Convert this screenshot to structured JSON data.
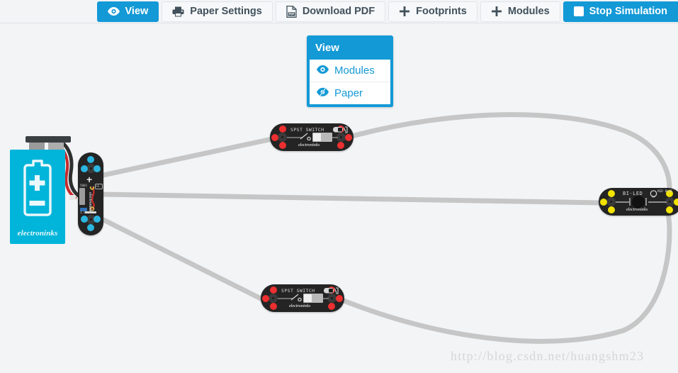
{
  "toolbar": {
    "buttons": [
      {
        "label": "View",
        "icon": "eye-icon",
        "style": "primary"
      },
      {
        "label": "Paper Settings",
        "icon": "printer-icon",
        "style": "default"
      },
      {
        "label": "Download PDF",
        "icon": "pdf-file-icon",
        "style": "default"
      },
      {
        "label": "Footprints",
        "icon": "plus-icon",
        "style": "default"
      },
      {
        "label": "Modules",
        "icon": "plus-icon",
        "style": "default"
      },
      {
        "label": "Stop Simulation",
        "icon": "stop-square-icon",
        "style": "primary"
      }
    ]
  },
  "view_dropdown": {
    "title": "View",
    "items": [
      {
        "label": "Modules",
        "icon": "eye-icon"
      },
      {
        "label": "Paper",
        "icon": "eye-slash-icon"
      }
    ]
  },
  "canvas": {
    "battery": {
      "brand": "electroninks",
      "symbol": "battery-plus-minus-icon"
    },
    "modules": [
      {
        "id": "power-module",
        "name": "power-module",
        "title": "",
        "brand": "electroninks",
        "pad_color": "#2bb6e0",
        "orientation": "vertical",
        "labels": {
          "part": "5001",
          "pin": "+1",
          "chip": "1.0",
          "chip2": "B4-5"
        }
      },
      {
        "id": "spst-switch-top",
        "name": "spst-switch-module",
        "title": "SPST SWITCH",
        "brand": "electroninks",
        "pad_color": "#ec2f2f",
        "orientation": "horizontal"
      },
      {
        "id": "spst-switch-bottom",
        "name": "spst-switch-module",
        "title": "SPST SWITCH",
        "brand": "electroninks",
        "pad_color": "#ec2f2f",
        "orientation": "horizontal"
      },
      {
        "id": "bi-led",
        "name": "bi-led-module",
        "title": "BI-LED",
        "subtitle": "RED BLUE",
        "brand": "electroninks",
        "pad_color": "#f2e300",
        "orientation": "horizontal"
      }
    ],
    "trace_color": "#c6c6c6"
  },
  "watermark": {
    "text": "http://blog.csdn.net/huangshm23"
  }
}
